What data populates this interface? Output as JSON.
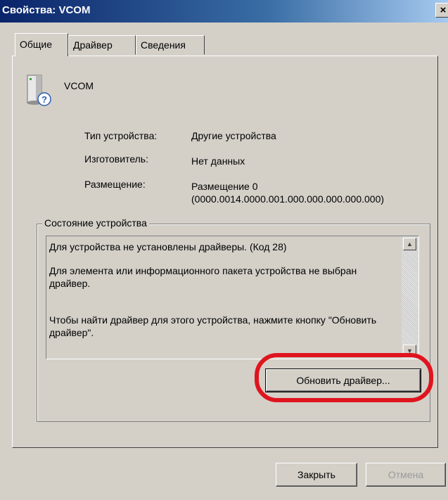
{
  "window": {
    "title": "Свойства: VCOM",
    "close_glyph": "×"
  },
  "tabs": [
    {
      "label": "Общие",
      "active": true
    },
    {
      "label": "Драйвер",
      "active": false
    },
    {
      "label": "Сведения",
      "active": false
    }
  ],
  "device": {
    "name": "VCOM",
    "icon": "unknown-device-icon",
    "type_label": "Тип устройства:",
    "type_value": "Другие устройства",
    "manufacturer_label": "Изготовитель:",
    "manufacturer_value": "Нет данных",
    "location_label": "Размещение:",
    "location_value_line1": "Размещение 0",
    "location_value_line2": "(0000.0014.0000.001.000.000.000.000.000)"
  },
  "status": {
    "group_title": "Состояние устройства",
    "line1": "Для устройства не установлены драйверы. (Код 28)",
    "line2": "Для элемента или информационного пакета устройства не выбран драйвер.",
    "line3": "Чтобы найти драйвер для этого устройства, нажмите кнопку \"Обновить драйвер\"."
  },
  "buttons": {
    "update_driver": "Обновить драйвер...",
    "close": "Закрыть",
    "cancel": "Отмена"
  },
  "colors": {
    "highlight": "#e0141e",
    "titlebar": "#0a246a"
  }
}
